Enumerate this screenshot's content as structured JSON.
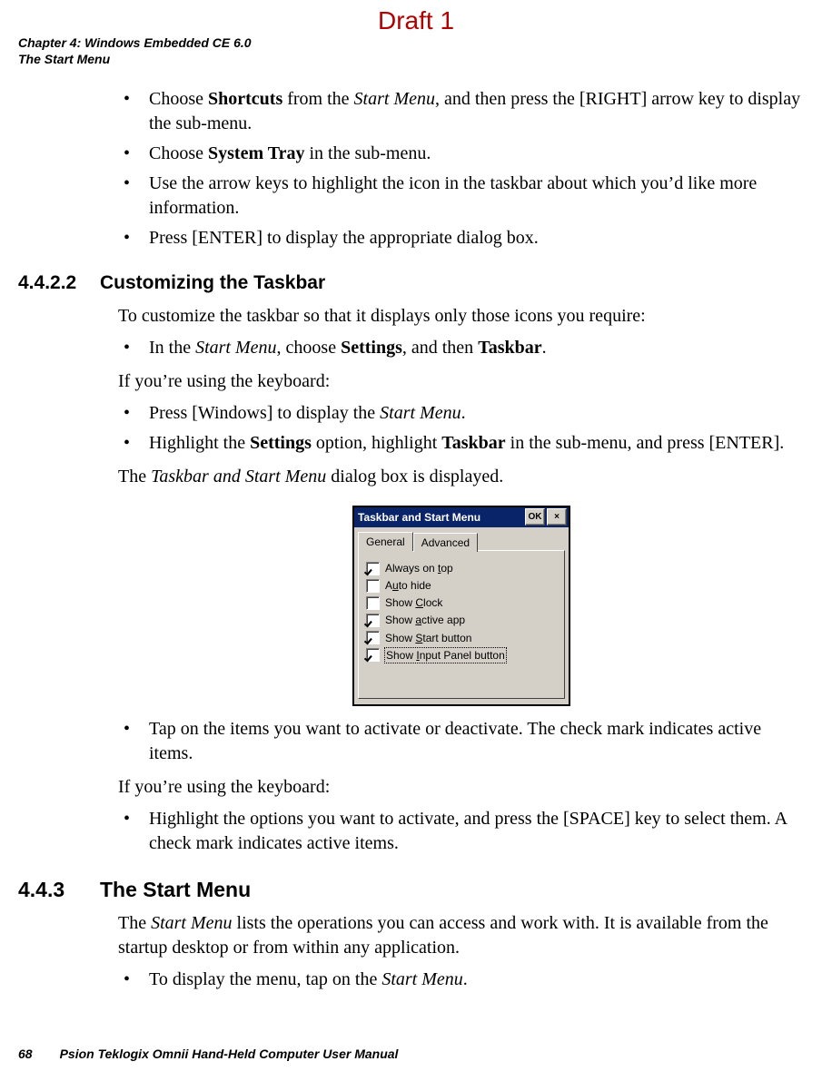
{
  "watermark": "Draft 1",
  "header": {
    "line1": "Chapter 4:  Windows Embedded CE 6.0",
    "line2": "The Start Menu"
  },
  "bullets_top": [
    {
      "pre": "Choose ",
      "bold1": "Shortcuts",
      "mid1": " from the ",
      "ital1": "Start Menu",
      "post": ", and then press the [RIGHT] arrow key to display the sub-menu."
    }
  ],
  "b2": {
    "pre": "Choose ",
    "bold": "System Tray",
    "post": " in the sub-menu."
  },
  "b3": "Use the arrow keys to highlight the icon in the taskbar about which you’d like more information.",
  "b4": "Press [ENTER] to display the appropriate dialog box.",
  "h4422": {
    "num": "4.4.2.2",
    "title": "Customizing the Taskbar"
  },
  "p_customize": "To customize the taskbar so that it displays only those icons you require:",
  "b5": {
    "pre": "In the ",
    "ital": "Start Menu",
    "mid": ", choose ",
    "bold1": "Settings",
    "mid2": ", and then ",
    "bold2": "Taskbar",
    "post": "."
  },
  "p_keyboard1": "If you’re using the keyboard:",
  "b6": {
    "pre": "Press [Windows] to display the ",
    "ital": "Start Menu",
    "post": "."
  },
  "b7": {
    "pre": "Highlight the ",
    "bold1": "Settings",
    "mid": " option, highlight ",
    "bold2": "Taskbar",
    "post": " in the sub-menu, and press [ENTER]."
  },
  "p_dialog": {
    "pre": "The ",
    "ital": "Taskbar and Start Menu",
    "post": " dialog box is displayed."
  },
  "dialog": {
    "title": "Taskbar and Start Menu",
    "ok": "OK",
    "close": "×",
    "tabs": {
      "general": "General",
      "advanced": "Advanced"
    },
    "rows": [
      {
        "checked": true,
        "label_pre": "Always on ",
        "label_u": "t",
        "label_post": "op"
      },
      {
        "checked": false,
        "label_pre": "A",
        "label_u": "u",
        "label_post": "to hide"
      },
      {
        "checked": false,
        "label_pre": "Show ",
        "label_u": "C",
        "label_post": "lock"
      },
      {
        "checked": true,
        "label_pre": "Show ",
        "label_u": "a",
        "label_post": "ctive app"
      },
      {
        "checked": true,
        "label_pre": "Show ",
        "label_u": "S",
        "label_post": "tart button"
      },
      {
        "checked": true,
        "label_pre": "Show ",
        "label_u": "I",
        "label_post": "nput Panel button",
        "selected": true
      }
    ]
  },
  "b8": "Tap on the items you want to activate or deactivate. The check mark indicates active items.",
  "p_keyboard2": "If you’re using the keyboard:",
  "b9": "Highlight the options you want to activate, and press the [SPACE] key to select them. A check mark indicates active items.",
  "h443": {
    "num": "4.4.3",
    "title": "The Start Menu"
  },
  "p_startmenu": {
    "pre": "The ",
    "ital": "Start Menu",
    "post": " lists the operations you can access and work with. It is available from the startup desktop or from within any application."
  },
  "b10": {
    "pre": "To display the menu, tap on the ",
    "ital": "Start Menu",
    "post": "."
  },
  "footer": {
    "page": "68",
    "book": "Psion Teklogix Omnii Hand-Held Computer User Manual"
  }
}
